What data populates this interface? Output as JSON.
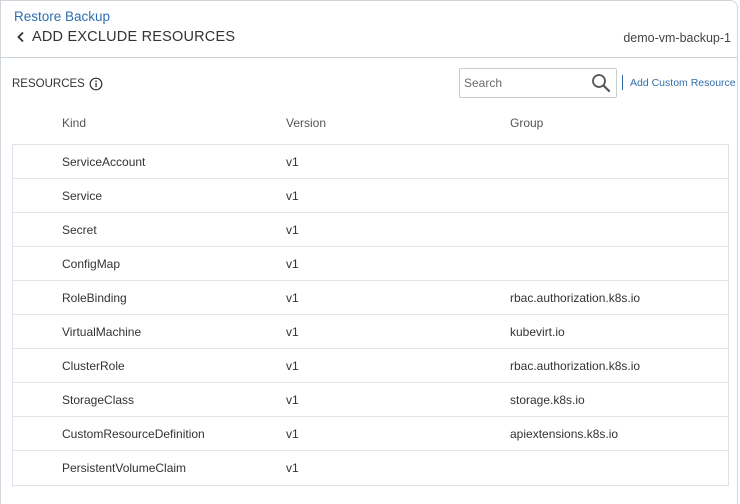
{
  "header": {
    "breadcrumb": "Restore Backup",
    "title": "ADD EXCLUDE RESOURCES",
    "backup_name": "demo-vm-backup-1"
  },
  "toolbar": {
    "resources_label": "RESOURCES",
    "search_placeholder": "Search",
    "search_value": "",
    "add_custom_label": "Add Custom Resource"
  },
  "table": {
    "columns": [
      "Kind",
      "Version",
      "Group"
    ],
    "rows": [
      {
        "kind": "ServiceAccount",
        "version": "v1",
        "group": ""
      },
      {
        "kind": "Service",
        "version": "v1",
        "group": ""
      },
      {
        "kind": "Secret",
        "version": "v1",
        "group": ""
      },
      {
        "kind": "ConfigMap",
        "version": "v1",
        "group": ""
      },
      {
        "kind": "RoleBinding",
        "version": "v1",
        "group": "rbac.authorization.k8s.io"
      },
      {
        "kind": "VirtualMachine",
        "version": "v1",
        "group": "kubevirt.io"
      },
      {
        "kind": "ClusterRole",
        "version": "v1",
        "group": "rbac.authorization.k8s.io"
      },
      {
        "kind": "StorageClass",
        "version": "v1",
        "group": "storage.k8s.io"
      },
      {
        "kind": "CustomResourceDefinition",
        "version": "v1",
        "group": "apiextensions.k8s.io"
      },
      {
        "kind": "PersistentVolumeClaim",
        "version": "v1",
        "group": ""
      }
    ]
  },
  "colors": {
    "link": "#2f6fad",
    "text": "#333333",
    "border": "#dfe3e7"
  },
  "icons": {
    "back": "chevron-left-icon",
    "info": "info-icon",
    "search": "search-icon"
  }
}
